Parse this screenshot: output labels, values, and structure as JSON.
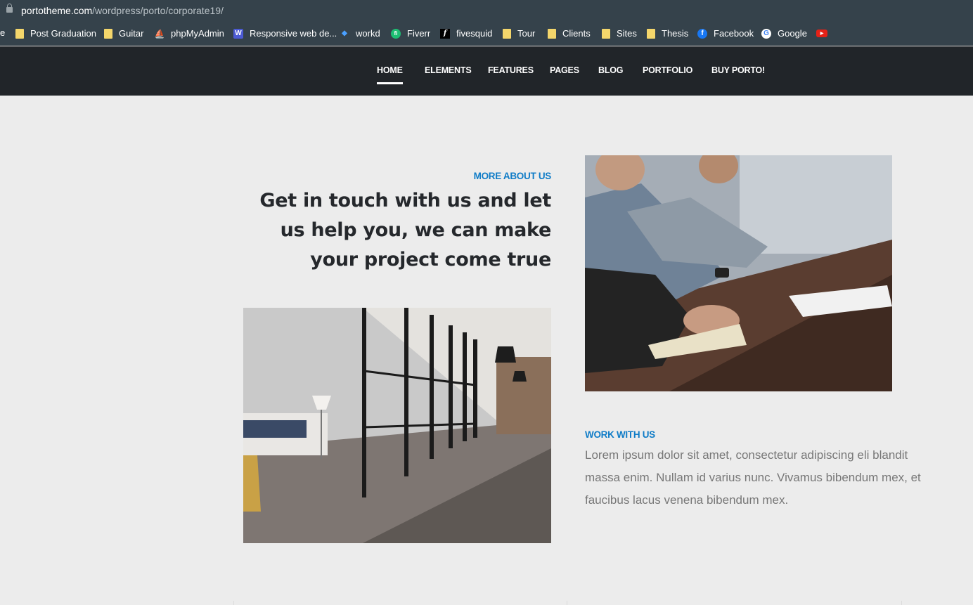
{
  "browser": {
    "url_host": "portotheme.com",
    "url_path": "/wordpress/porto/corporate19/",
    "left_edge_fragment": "e",
    "bookmarks": [
      {
        "label": "Post Graduation",
        "icon": "folder-icon"
      },
      {
        "label": "Guitar",
        "icon": "folder-icon"
      },
      {
        "label": "phpMyAdmin",
        "icon": "phpmyadmin-icon"
      },
      {
        "label": "Responsive web de...",
        "icon": "webflow-icon"
      },
      {
        "label": "workd",
        "icon": "workd-icon"
      },
      {
        "label": "Fiverr",
        "icon": "fiverr-icon"
      },
      {
        "label": "fivesquid",
        "icon": "fivesquid-icon"
      },
      {
        "label": "Tour",
        "icon": "folder-icon"
      },
      {
        "label": "Clients",
        "icon": "folder-icon"
      },
      {
        "label": "Sites",
        "icon": "folder-icon"
      },
      {
        "label": "Thesis",
        "icon": "folder-icon"
      },
      {
        "label": "Facebook",
        "icon": "facebook-icon"
      },
      {
        "label": "Google",
        "icon": "google-icon"
      },
      {
        "label": "",
        "icon": "youtube-icon"
      }
    ]
  },
  "nav": {
    "items": [
      "HOME",
      "ELEMENTS",
      "FEATURES",
      "PAGES",
      "BLOG",
      "PORTFOLIO",
      "BUY PORTO!"
    ],
    "active": "HOME"
  },
  "about": {
    "kicker": "MORE ABOUT US",
    "headline": "Get in touch with us and let us help you, we can make your project come true"
  },
  "work": {
    "kicker": "WORK WITH US",
    "body": "Lorem ipsum dolor sit amet, consectetur adipiscing eli blandit massa enim. Nullam id varius nunc. Vivamus bibendum mex, et faucibus lacus venena bibendum mex."
  },
  "colors": {
    "chrome": "#35424b",
    "nav_bg": "#212529",
    "page_bg": "#ececec",
    "accent": "#0f7cc7",
    "heading": "#25282c",
    "body_text": "#777777"
  }
}
